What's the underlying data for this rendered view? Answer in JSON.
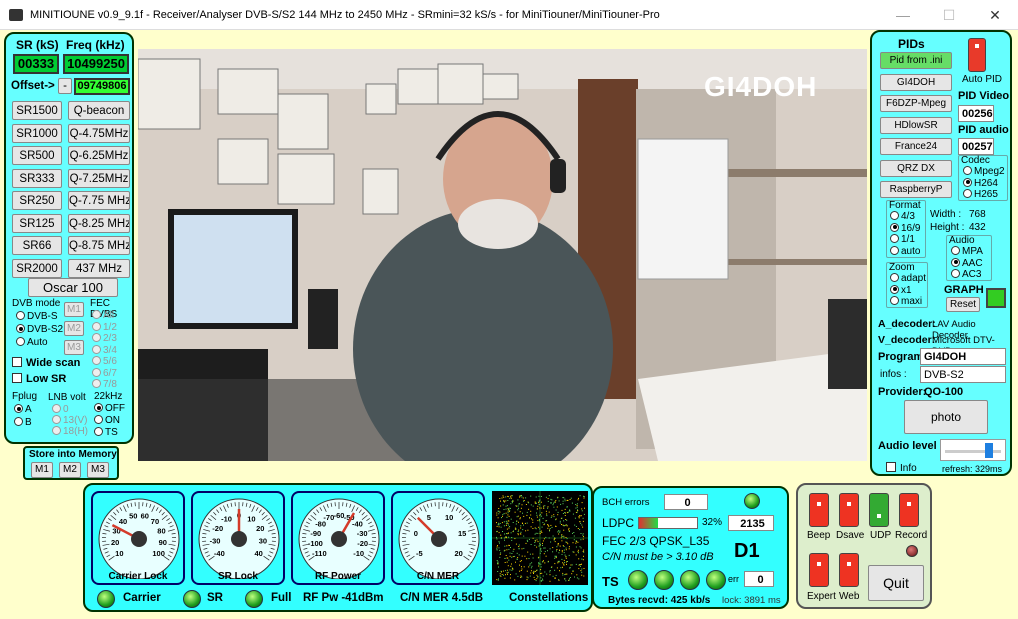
{
  "window": {
    "title": "MINITIOUNE v0.9_9.1f - Receiver/Analyser DVB-S/S2 144 MHz to 2450 MHz - SRmini=32 kS/s - for MiniTiouner/MiniTiouner-Pro",
    "minimize": "—",
    "maximize": "☐",
    "close": "✕"
  },
  "left": {
    "sr_label": "SR (kS)",
    "freq_label": "Freq (kHz)",
    "sr_value": "00333",
    "freq_value": "10499250",
    "offset_label": "Offset->",
    "offset_btn": "-",
    "offset_value": "09749806",
    "sr_buttons": [
      "SR1500",
      "SR1000",
      "SR500",
      "SR333",
      "SR250",
      "SR125",
      "SR66",
      "SR2000"
    ],
    "q_buttons": [
      "Q-beacon",
      "Q-4.75MHz",
      "Q-6.25MHz",
      "Q-7.25MHz",
      "Q-7.75 MHz",
      "Q-8.25 MHz",
      "Q-8.75 MHz",
      "437 MHz"
    ],
    "oscar": "Oscar 100",
    "dvb_mode_label": "DVB mode",
    "dvb_modes": [
      "DVB-S",
      "DVB-S2",
      "Auto"
    ],
    "mem_small": [
      "M1",
      "M2",
      "M3"
    ],
    "fec_label": "FEC DVBS",
    "fec": [
      "All",
      "1/2",
      "2/3",
      "3/4",
      "5/6",
      "6/7",
      "7/8"
    ],
    "wide_scan": "Wide scan",
    "low_sr": "Low SR",
    "fplug_label": "Fplug",
    "fplug": [
      "A",
      "B"
    ],
    "lnb_label": "LNB volt",
    "lnb": [
      "0",
      "13(V)",
      "18(H)"
    ],
    "k22_label": "22kHz",
    "k22": [
      "OFF",
      "ON",
      "TS"
    ],
    "store_label": "Store into Memory",
    "store": [
      "M1",
      "M2",
      "M3"
    ]
  },
  "video": {
    "overlay": "GI4DOH"
  },
  "right": {
    "pids_label": "PIDs",
    "pid_buttons": [
      "Pid from .ini",
      "GI4DOH",
      "F6DZP-Mpeg",
      "HDlowSR",
      "France24",
      "QRZ DX",
      "RaspberryP"
    ],
    "auto_pid": "Auto PID",
    "pid_video_label": "PID Video",
    "pid_video": "00256",
    "pid_audio_label": "PID audio",
    "pid_audio": "00257",
    "codec_label": "Codec",
    "codecs": [
      "Mpeg2",
      "H264",
      "H265"
    ],
    "format_label": "Format",
    "formats": [
      "4/3",
      "16/9",
      "1/1",
      "auto"
    ],
    "width_label": "Width :",
    "width": "768",
    "height_label": "Height :",
    "height": "432",
    "audio_label": "Audio",
    "audios": [
      "MPA",
      "AAC",
      "AC3"
    ],
    "zoom_label": "Zoom",
    "zooms": [
      "adapt",
      "x1",
      "maxi"
    ],
    "graph_label": "GRAPH",
    "reset": "Reset",
    "a_decoder_label": "A_decoder:",
    "a_decoder": "LAV Audio Decoder",
    "v_decoder_label": "V_decoder:",
    "v_decoder": "Microsoft DTV-DVD",
    "program_label": "Program",
    "program": "GI4DOH",
    "infos_label": "infos :",
    "infos": "DVB-S2",
    "provider_label": "Provider:",
    "provider": "QO-100",
    "photo": "photo",
    "audio_level": "Audio level",
    "info": "Info",
    "refresh": "refresh: 329ms"
  },
  "gauges": [
    {
      "name": "Carrier Lock",
      "ticks": [
        "10",
        "20",
        "30",
        "40",
        "50",
        "60",
        "70",
        "80",
        "90",
        "100"
      ],
      "value": 0.25
    },
    {
      "name": "SR Lock",
      "ticks": [
        "-40",
        "-30",
        "-20",
        "-10",
        "0",
        "10",
        "20",
        "30",
        "40"
      ],
      "value": 0.5
    },
    {
      "name": "RF Power",
      "ticks": [
        "-110",
        "-100",
        "-90",
        "-80",
        "-70",
        "-60",
        "-50",
        "-40",
        "-30",
        "-20",
        "-10"
      ],
      "value": 0.62
    },
    {
      "name": "C/N MER",
      "ticks": [
        "-5",
        "0",
        "5",
        "10",
        "15",
        "20"
      ],
      "value": 0.32
    }
  ],
  "status": {
    "carrier": "Carrier",
    "sr": "SR",
    "full": "Full",
    "rf": "RF Pw -41dBm",
    "cn": "C/N MER 4.5dB",
    "const": "Constellations"
  },
  "decode": {
    "bch_label": "BCH errors",
    "bch": "0",
    "ldpc_label": "LDPC",
    "ldpc_pct": "32%",
    "ldpc_fill": 0.32,
    "ldpc_val": "2135",
    "fec": "FEC  2/3 QPSK_L35",
    "cn_text": "C/N must be > 3.10 dB",
    "d": "D1",
    "ts": "TS",
    "err_label": "err",
    "err": "0",
    "bytes": "Bytes recvd:  425 kb/s",
    "lock": "lock: 3891 ms"
  },
  "controls": {
    "beep": "Beep",
    "dsave": "Dsave",
    "udp": "UDP",
    "record": "Record",
    "expert": "Expert",
    "web": "Web",
    "quit": "Quit"
  },
  "colors": {
    "panel": "#66ffff",
    "lcd": "#00cc33",
    "led": "#33cc33",
    "toggle_red": "#ee3322",
    "bg": "#ffffcc"
  }
}
